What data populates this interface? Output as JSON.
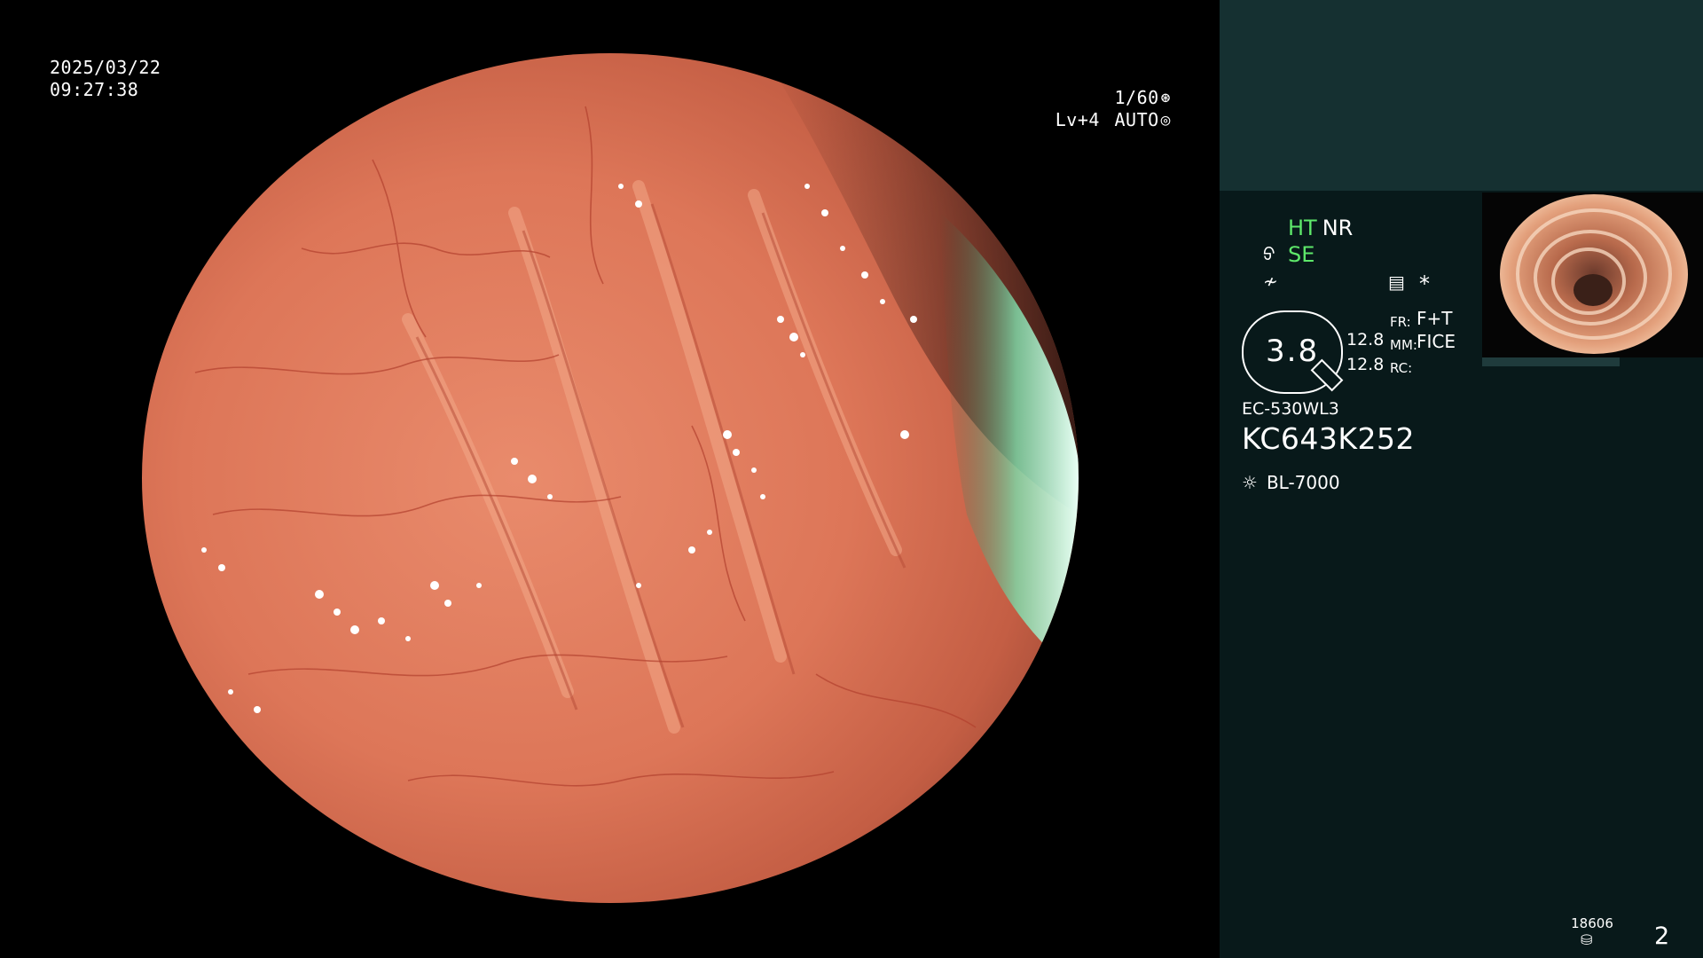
{
  "overlay": {
    "date": "2025/03/22",
    "time": "09:27:38",
    "shutter": "1/60",
    "shutter_icon": "aperture-icon",
    "level": "Lv+4",
    "mode": "AUTO",
    "mode_icon": "auto-iris-icon"
  },
  "panel": {
    "ht": "HT",
    "nr": "NR",
    "se": "SE",
    "zoom_value": "3.8",
    "val_top": "12.8",
    "val_bottom": "12.8",
    "fr_label": "FR:",
    "mm_label": "MM:",
    "rc_label": "RC:",
    "fr_value": "F+T",
    "mm_value": "FICE",
    "scope_model": "EC-530WL3",
    "scope_serial": "KC643K252",
    "light_source": "BL-7000",
    "counter_small": "18606",
    "page_number": "2"
  },
  "colors": {
    "panel_bg": "#08191a",
    "panel_top_bg": "#153031",
    "mode_green": "#5ee86a",
    "tissue": "#d9735a"
  }
}
